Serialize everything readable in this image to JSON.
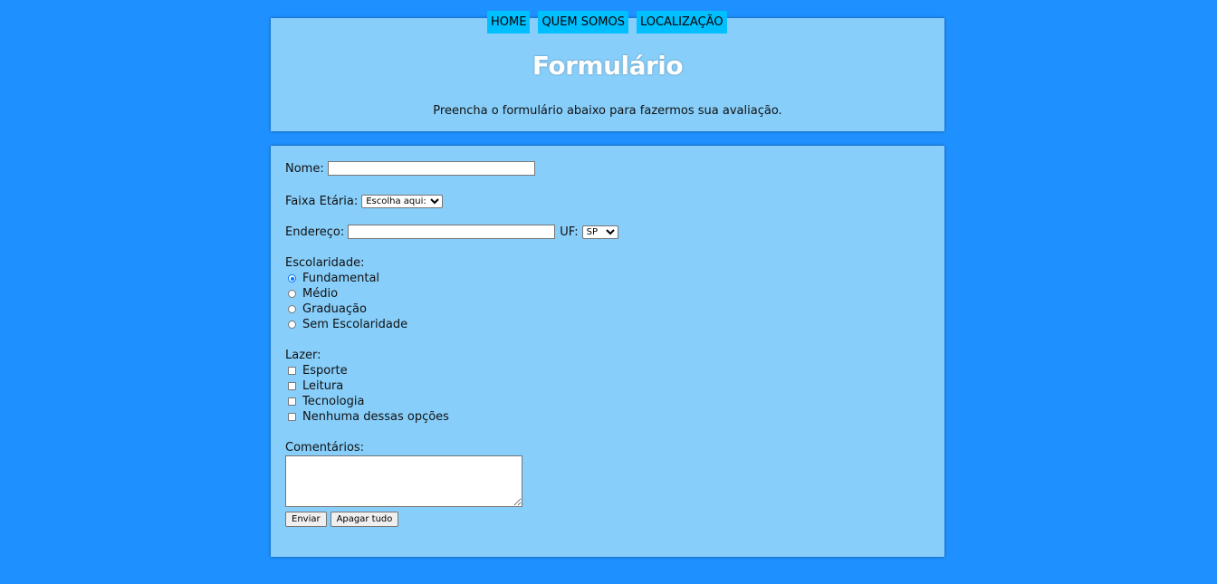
{
  "nav": {
    "items": [
      {
        "label": "HOME"
      },
      {
        "label": "QUEM SOMOS"
      },
      {
        "label": "LOCALIZAÇÃO"
      }
    ]
  },
  "header": {
    "title": "Formulário",
    "subtitle": "Preencha o formulário abaixo para fazermos sua avaliação."
  },
  "form": {
    "name_label": "Nome:",
    "name_value": "",
    "age_label": "Faixa Etária:",
    "age_selected": "Escolha aqui:",
    "address_label": "Endereço:",
    "address_value": "",
    "uf_label": "UF:",
    "uf_selected": "SP",
    "education": {
      "title": "Escolaridade:",
      "options": [
        {
          "label": "Fundamental",
          "checked": true
        },
        {
          "label": "Médio",
          "checked": false
        },
        {
          "label": "Graduação",
          "checked": false
        },
        {
          "label": "Sem Escolaridade",
          "checked": false
        }
      ]
    },
    "leisure": {
      "title": "Lazer:",
      "options": [
        {
          "label": "Esporte",
          "checked": false
        },
        {
          "label": "Leitura",
          "checked": false
        },
        {
          "label": "Tecnologia",
          "checked": false
        },
        {
          "label": "Nenhuma dessas opções",
          "checked": false
        }
      ]
    },
    "comments_label": "Comentários:",
    "comments_value": "",
    "submit_label": "Enviar",
    "reset_label": "Apagar tudo"
  },
  "colors": {
    "background": "#1e90ff",
    "panel": "#87cefa",
    "nav_button": "#00bfff",
    "title_text": "#ffffff"
  }
}
